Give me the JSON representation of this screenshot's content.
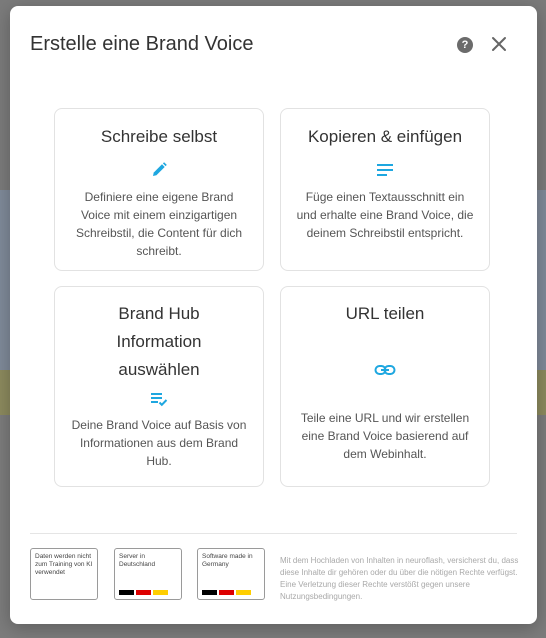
{
  "modal": {
    "title": "Erstelle eine Brand Voice",
    "help_label": "?",
    "close_label": "close"
  },
  "cards": [
    {
      "title": "Schreibe selbst",
      "icon": "pencil-icon",
      "description": "Definiere eine eigene Brand Voice mit einem einzigartigen Schreibstil, die Content für dich schreibt."
    },
    {
      "title": "Kopieren & einfügen",
      "icon": "text-lines-icon",
      "description": "Füge einen Textausschnitt ein und erhalte eine Brand Voice, die deinem Schreibstil entspricht."
    },
    {
      "title": "Brand Hub Information auswählen",
      "icon": "list-check-icon",
      "description": "Deine Brand Voice auf Basis von Informationen aus dem Brand Hub."
    },
    {
      "title": "URL teilen",
      "icon": "link-icon",
      "description": "Teile eine URL und wir erstellen eine Brand Voice basierend auf dem Webinhalt."
    }
  ],
  "badges": [
    {
      "text": "Daten werden nicht zum Training von KI verwendet"
    },
    {
      "text": "Server in Deutschland"
    },
    {
      "text": "Software made in Germany"
    }
  ],
  "disclaimer": "Mit dem Hochladen von Inhalten in neuroflash, versicherst du, dass diese Inhalte dir gehören oder du über die nötigen Rechte verfügst. Eine Verletzung dieser Rechte verstößt gegen unsere Nutzungsbedingungen.",
  "colors": {
    "accent": "#1ea7e0",
    "flag_black": "#000000",
    "flag_red": "#dd0000",
    "flag_gold": "#ffce00"
  }
}
